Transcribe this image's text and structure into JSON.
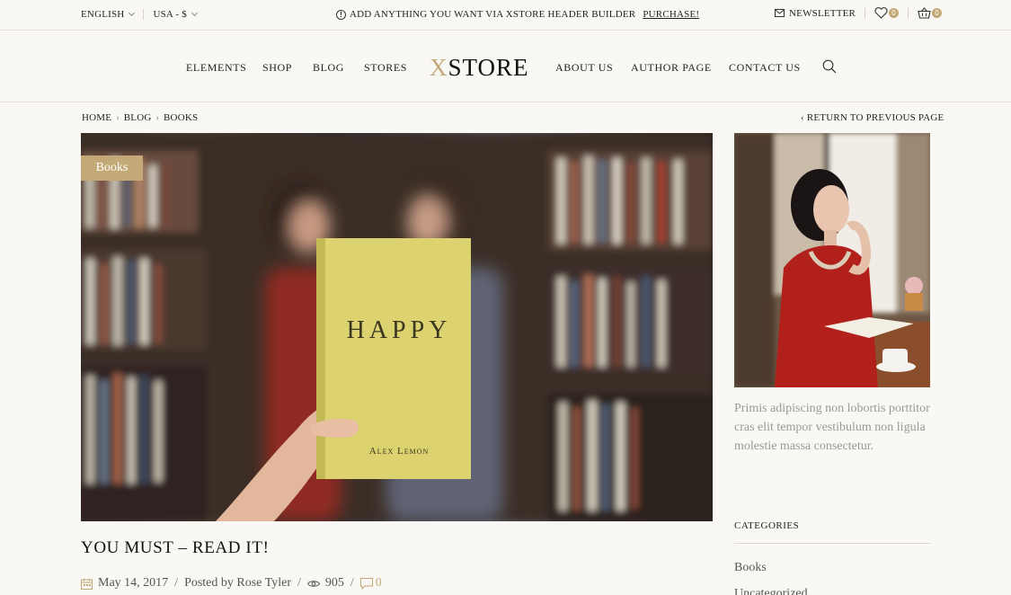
{
  "topbar": {
    "language": "ENGLISH",
    "currency": "USA - $",
    "announcement": "ADD ANYTHING YOU WANT VIA XSTORE HEADER BUILDER",
    "purchase_label": "PURCHASE!",
    "newsletter_label": "NEWSLETTER",
    "wishlist_count": "0",
    "cart_count": "0"
  },
  "nav": {
    "left_items": [
      "ELEMENTS",
      "SHOP",
      "BLOG",
      "STORES"
    ],
    "right_items": [
      "ABOUT US",
      "AUTHOR PAGE",
      "CONTACT US"
    ],
    "logo_x": "X",
    "logo_rest": "STORE"
  },
  "breadcrumb": {
    "items": [
      "HOME",
      "BLOG",
      "BOOKS"
    ],
    "separator": "›",
    "return_label": "‹ RETURN TO PREVIOUS PAGE"
  },
  "post": {
    "category_tag": "Books",
    "book_title": "HAPPY",
    "book_author": "Alex Lemon",
    "title": "YOU MUST – READ IT!",
    "date": "May 14, 2017",
    "posted_by_label": "Posted by",
    "author": "Rose Tyler",
    "views": "905",
    "comments": "0"
  },
  "sidebar": {
    "about_text": "Primis adipiscing non lobortis porttitor cras elit tempor vestibulum non ligula molestie massa consectetur.",
    "categories_title": "CATEGORIES",
    "categories": [
      "Books",
      "Uncategorized"
    ]
  },
  "colors": {
    "accent": "#c3a977",
    "background": "#f9f8f5",
    "text": "#222222",
    "muted_text": "#999999"
  },
  "icons": {
    "info": "info-circle-icon",
    "newsletter": "envelope-icon",
    "wishlist": "heart-icon",
    "cart": "basket-icon",
    "search": "search-icon",
    "date": "calendar-icon",
    "views": "eye-icon",
    "comments": "comment-icon"
  }
}
